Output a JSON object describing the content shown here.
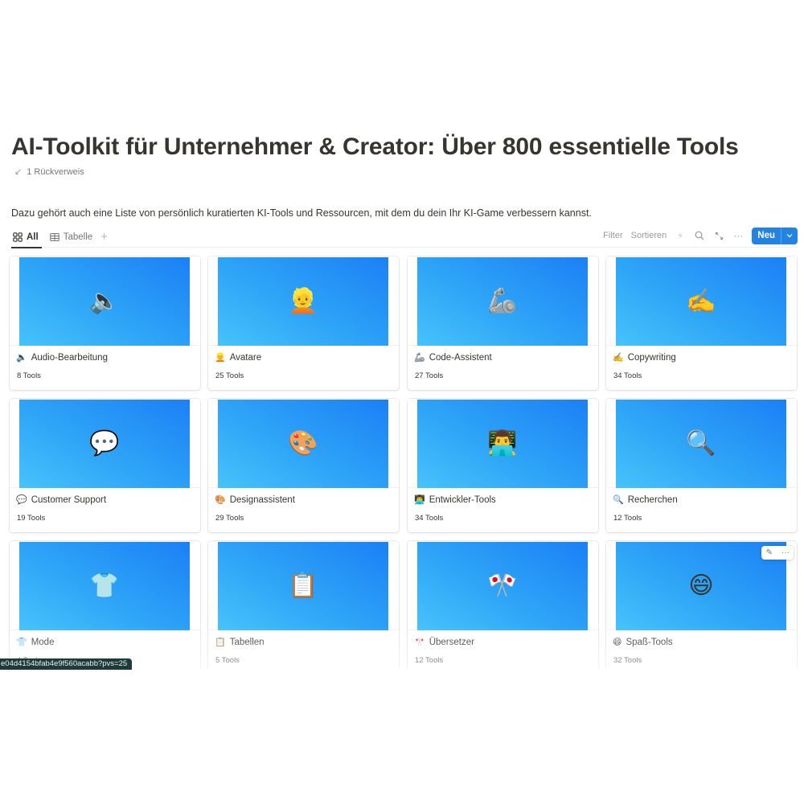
{
  "page": {
    "title": "AI-Toolkit für Unternehmer & Creator: Über 800 essentielle Tools",
    "backlinks_label": "1 Rückverweis",
    "description": "Dazu gehört auch eine Liste von persönlich kuratierten KI-Tools und Ressourcen, mit dem du dein Ihr KI-Game verbessern kannst."
  },
  "views": {
    "tabs": [
      {
        "label": "All",
        "icon": "gallery-grid-icon",
        "active": true
      },
      {
        "label": "Tabelle",
        "icon": "table-icon",
        "active": false
      }
    ],
    "add_view_label": "+"
  },
  "toolbar": {
    "filter_label": "Filter",
    "sort_label": "Sortieren",
    "automation_icon": "⚡",
    "search_icon": "⌕",
    "expand_icon": "⤡",
    "more_icon": "···",
    "new_label": "Neu",
    "new_dropdown_icon": "⌄"
  },
  "colors": {
    "accent": "#2383e2",
    "cover_gradient_start": "#46c3fb",
    "cover_gradient_end": "#1b80f6",
    "text": "#37352f",
    "muted": "#787774"
  },
  "cards": [
    {
      "emoji": "🔈",
      "title": "Audio-Bearbeitung",
      "count": "8 Tools"
    },
    {
      "emoji": "👱",
      "title": "Avatare",
      "count": "25 Tools"
    },
    {
      "emoji": "🦾",
      "title": "Code-Assistent",
      "count": "27 Tools"
    },
    {
      "emoji": "✍️",
      "title": "Copywriting",
      "count": "34 Tools"
    },
    {
      "emoji": "💬",
      "title": "Customer Support",
      "count": "19 Tools"
    },
    {
      "emoji": "🎨",
      "title": "Designassistent",
      "count": "29 Tools"
    },
    {
      "emoji": "👨‍💻",
      "title": "Entwickler-Tools",
      "count": "34 Tools"
    },
    {
      "emoji": "🔍",
      "title": "Recherchen",
      "count": "12 Tools"
    },
    {
      "emoji": "👕",
      "title": "Mode",
      "count": "4 Tools"
    },
    {
      "emoji": "📋",
      "title": "Tabellen",
      "count": "5 Tools"
    },
    {
      "emoji": "🎌",
      "title": "Übersetzer",
      "count": "12 Tools"
    },
    {
      "emoji": "😄",
      "title": "Spaß-Tools",
      "count": "32 Tools"
    }
  ],
  "card_hover_actions": {
    "edit_icon": "✎",
    "more_icon": "···"
  },
  "status_bar": {
    "url_text": "e04d4154bfab4e9f560acabb?pvs=25"
  }
}
